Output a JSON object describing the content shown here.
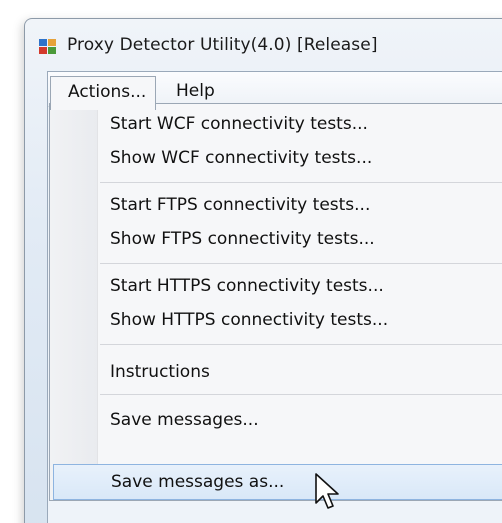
{
  "window": {
    "title": "Proxy Detector Utility(4.0) [Release]",
    "icon": "app-icon"
  },
  "menubar": {
    "actions_label": "Actions...",
    "help_label": "Help"
  },
  "dropdown": {
    "items": [
      {
        "label": "Start WCF connectivity tests..."
      },
      {
        "label": "Show WCF connectivity tests..."
      },
      {
        "label": "Start FTPS connectivity tests..."
      },
      {
        "label": "Show FTPS connectivity tests..."
      },
      {
        "label": "Start HTTPS connectivity tests..."
      },
      {
        "label": "Show HTTPS connectivity tests..."
      },
      {
        "label": "Instructions"
      },
      {
        "label": "Save messages..."
      },
      {
        "label": "Save messages as..."
      }
    ],
    "highlighted_item": "Save messages as..."
  },
  "cursor": {
    "icon": "arrow-pointer-icon"
  },
  "colors": {
    "highlight_bg": "#d9e8f8",
    "highlight_border": "#8eb4e0",
    "menu_bg": "#f6f7f9"
  }
}
